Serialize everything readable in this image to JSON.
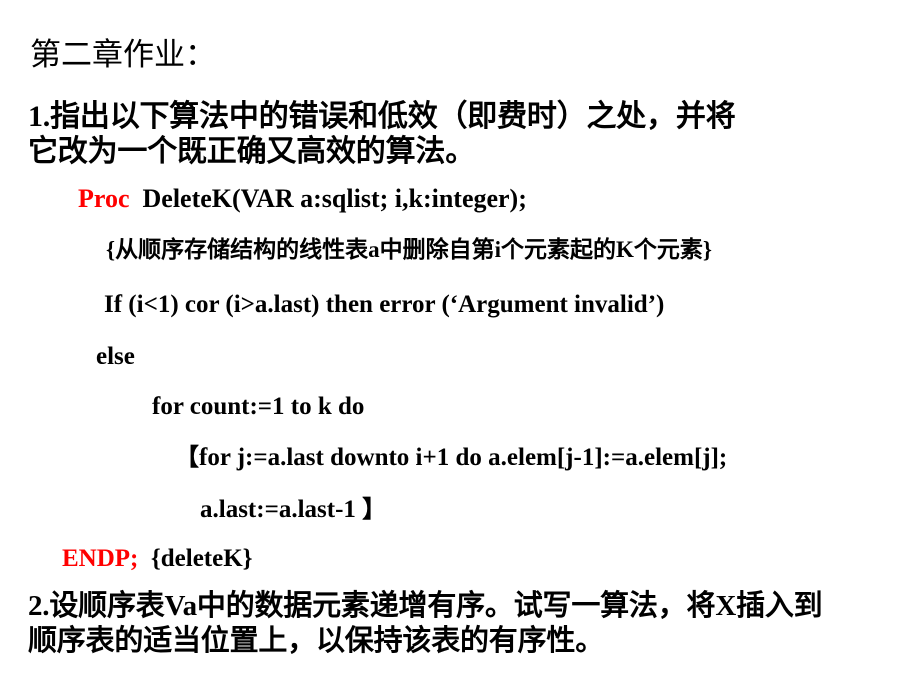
{
  "slide": {
    "title": "第二章作业：",
    "background_color": "#ffffff",
    "text_color": "#000000",
    "accent_color": "#ff0000"
  },
  "question1": {
    "lines": [
      "1.指出以下算法中的错误和低效（即费时）之处，并将",
      "它改为一个既正确又高效的算法。"
    ]
  },
  "code": {
    "proc_keyword": "Proc",
    "proc_signature": "DeleteK(VAR a:sqlist; i,k:integer);",
    "comment_block": "{从顺序存储结构的线性表a中删除自第i个元素起的K个元素}",
    "if_line": "If  (i<1)  cor  (i>a.last)   then   error (‘Argument  invalid’)",
    "else_line": "else",
    "for_outer": "for  count:=1  to  k  do",
    "bracket_open": "【",
    "for_inner": "for  j:=a.last  downto   i+1   do a.elem[j-1]:=a.elem[j];",
    "assign_last": "a.last:=a.last-1 ",
    "bracket_close": "】",
    "endp_keyword": "ENDP;",
    "endp_comment": "{deleteK}"
  },
  "question2": {
    "lines": [
      "2.设顺序表Va中的数据元素递增有序。试写一算法，将X插入到",
      "顺序表的适当位置上，以保持该表的有序性。"
    ]
  }
}
